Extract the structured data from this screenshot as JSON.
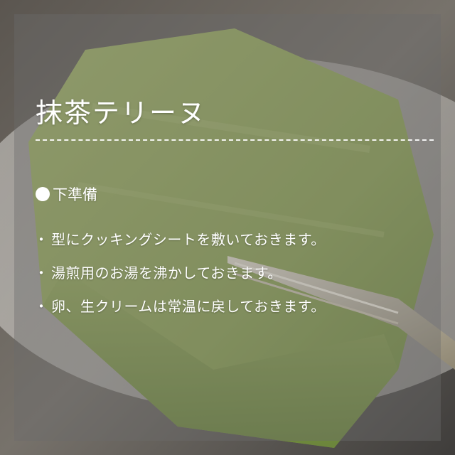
{
  "title": "抹茶テリーヌ",
  "section": {
    "heading": "下準備"
  },
  "steps": [
    "型にクッキングシートを敷いておきます。",
    "湯煎用のお湯を沸かしておきます。",
    "卵、生クリームは常温に戻しておきます。"
  ],
  "bullet_char": "・",
  "colors": {
    "text": "#ffffff",
    "overlay": "#6c6c6c",
    "matcha": "#8fa55a"
  }
}
